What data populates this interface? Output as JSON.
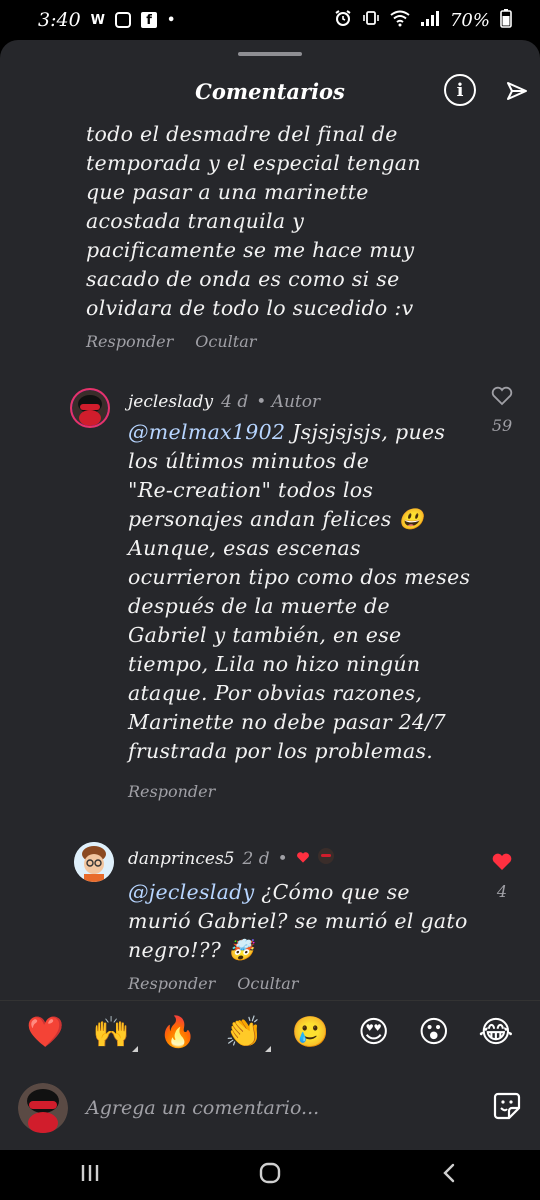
{
  "status_bar": {
    "time": "3:40",
    "w_icon": "W",
    "fb_icon": "f",
    "dot": "•",
    "battery": "70%",
    "icons": [
      "alarm-icon",
      "vibrate-icon",
      "wifi-icon",
      "signal-icon"
    ]
  },
  "header": {
    "title": "Comentarios",
    "info_icon": "i"
  },
  "comments": [
    {
      "id": "c1",
      "lines": [
        "todo el desmadre del final de",
        "temporada y el especial tengan",
        "que pasar a una marinette",
        "acostada tranquila y",
        "pacificamente  se me hace muy",
        "sacado de onda es como si se",
        "olvidara de todo lo sucedido :v"
      ],
      "actions": [
        "Responder",
        "Ocultar"
      ]
    },
    {
      "id": "c2",
      "username": "jecleslady",
      "age": "4 d",
      "badge": "• Autor",
      "mention": "@melmax1902",
      "lines": [
        " Jsjsjsjsjs, pues",
        "los últimos minutos de",
        "\"Re-creation\" todos los",
        "personajes andan felices 😃",
        "Aunque, esas escenas",
        "ocurrieron tipo como dos meses",
        "después de la muerte de",
        "Gabriel y también, en ese",
        "tiempo, Lila no hizo ningún",
        "ataque. Por obvias razones,",
        "Marinette no debe pasar 24/7",
        "frustrada por los problemas."
      ],
      "likes": "59",
      "actions": [
        "Responder"
      ]
    },
    {
      "id": "c3",
      "username": "danprinces5",
      "age": "2 d",
      "badge": "•",
      "mention": "@jecleslady",
      "lines": [
        " ¿Cómo que se",
        "murió Gabriel? se murió el gato",
        "negro!?? 🤯"
      ],
      "likes": "4",
      "actions": [
        "Responder",
        "Ocultar"
      ]
    }
  ],
  "reactions": [
    "❤️",
    "🙌",
    "🔥",
    "👏",
    "🥲",
    "😍",
    "😮",
    "😂"
  ],
  "composer": {
    "placeholder": "Agrega un comentario..."
  },
  "colors": {
    "sheet_bg": "#26272b",
    "like_red": "#ff3040",
    "mention": "#b7d5ff"
  }
}
